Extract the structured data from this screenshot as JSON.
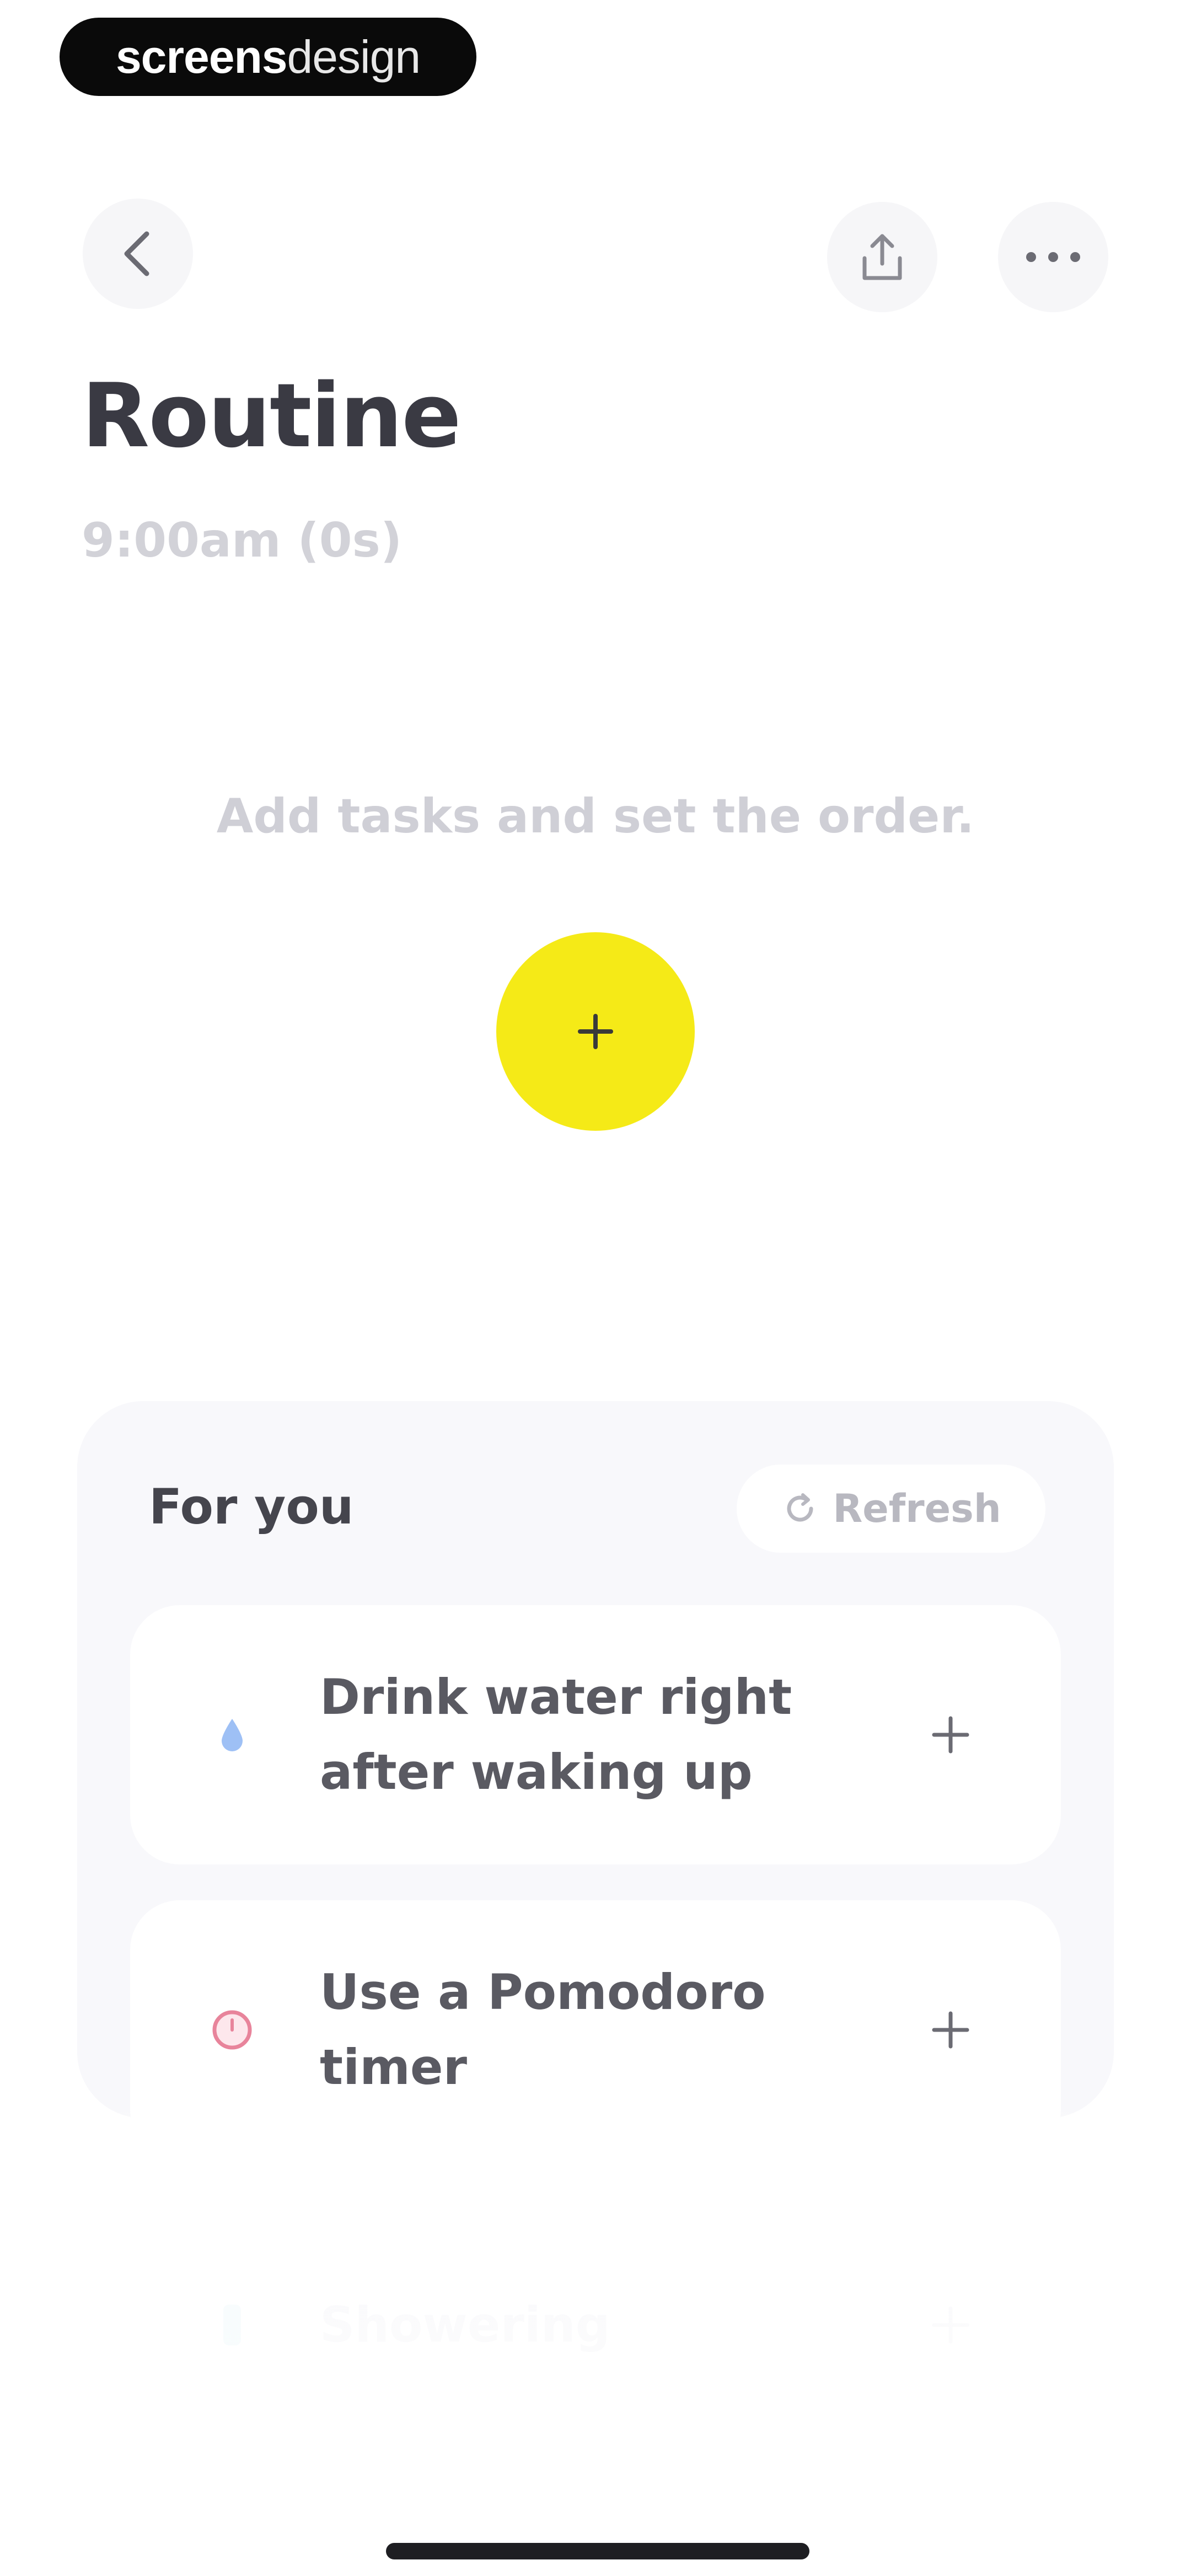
{
  "watermark": {
    "bold_part": "screens",
    "light_part": "design"
  },
  "header": {
    "title": "Routine",
    "subtitle": "9:00am (0s)"
  },
  "empty_state": {
    "message": "Add tasks and set the order."
  },
  "for_you": {
    "title": "For you",
    "refresh_label": "Refresh",
    "items": [
      {
        "label": "Drink water right after waking up",
        "icon": "water-drop-icon"
      },
      {
        "label": "Use a Pomodoro timer",
        "icon": "timer-icon"
      },
      {
        "label": "Showering",
        "icon": "shower-icon"
      }
    ]
  },
  "colors": {
    "accent": "#f5ea17",
    "text_primary": "#3a3a43",
    "text_muted": "#d2d2d8",
    "panel_bg": "#f8f8fb"
  }
}
